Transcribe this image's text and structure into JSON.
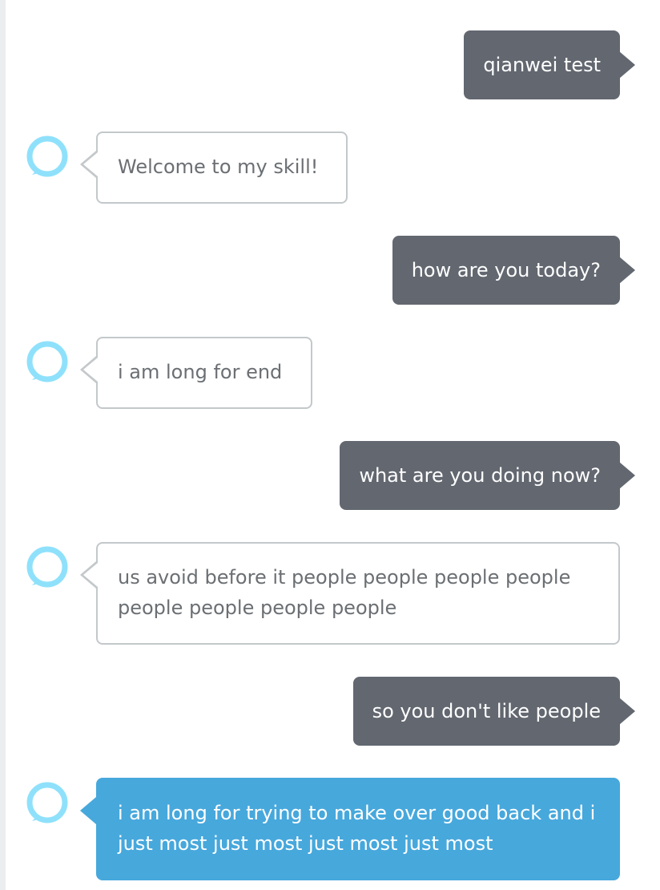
{
  "colors": {
    "user_bubble": "#626770",
    "alexa_border": "#c3c8cb",
    "alexa_text": "#6b6f73",
    "alexa_highlight": "#47a8dc",
    "avatar_ring": "#8fe1fb"
  },
  "avatar_icon": "alexa-ring-icon",
  "messages": [
    {
      "speaker": "user",
      "text": "qianwei test"
    },
    {
      "speaker": "alexa",
      "text": "Welcome to my skill!"
    },
    {
      "speaker": "user",
      "text": "how are you today?"
    },
    {
      "speaker": "alexa",
      "text": "i am long for end"
    },
    {
      "speaker": "user",
      "text": "what are you doing now?"
    },
    {
      "speaker": "alexa",
      "text": "us avoid before it people people people people people people people people"
    },
    {
      "speaker": "user",
      "text": "so you don't like people"
    },
    {
      "speaker": "alexa",
      "text": "i am long for trying to make over good back and i just most just most just most just most"
    }
  ]
}
